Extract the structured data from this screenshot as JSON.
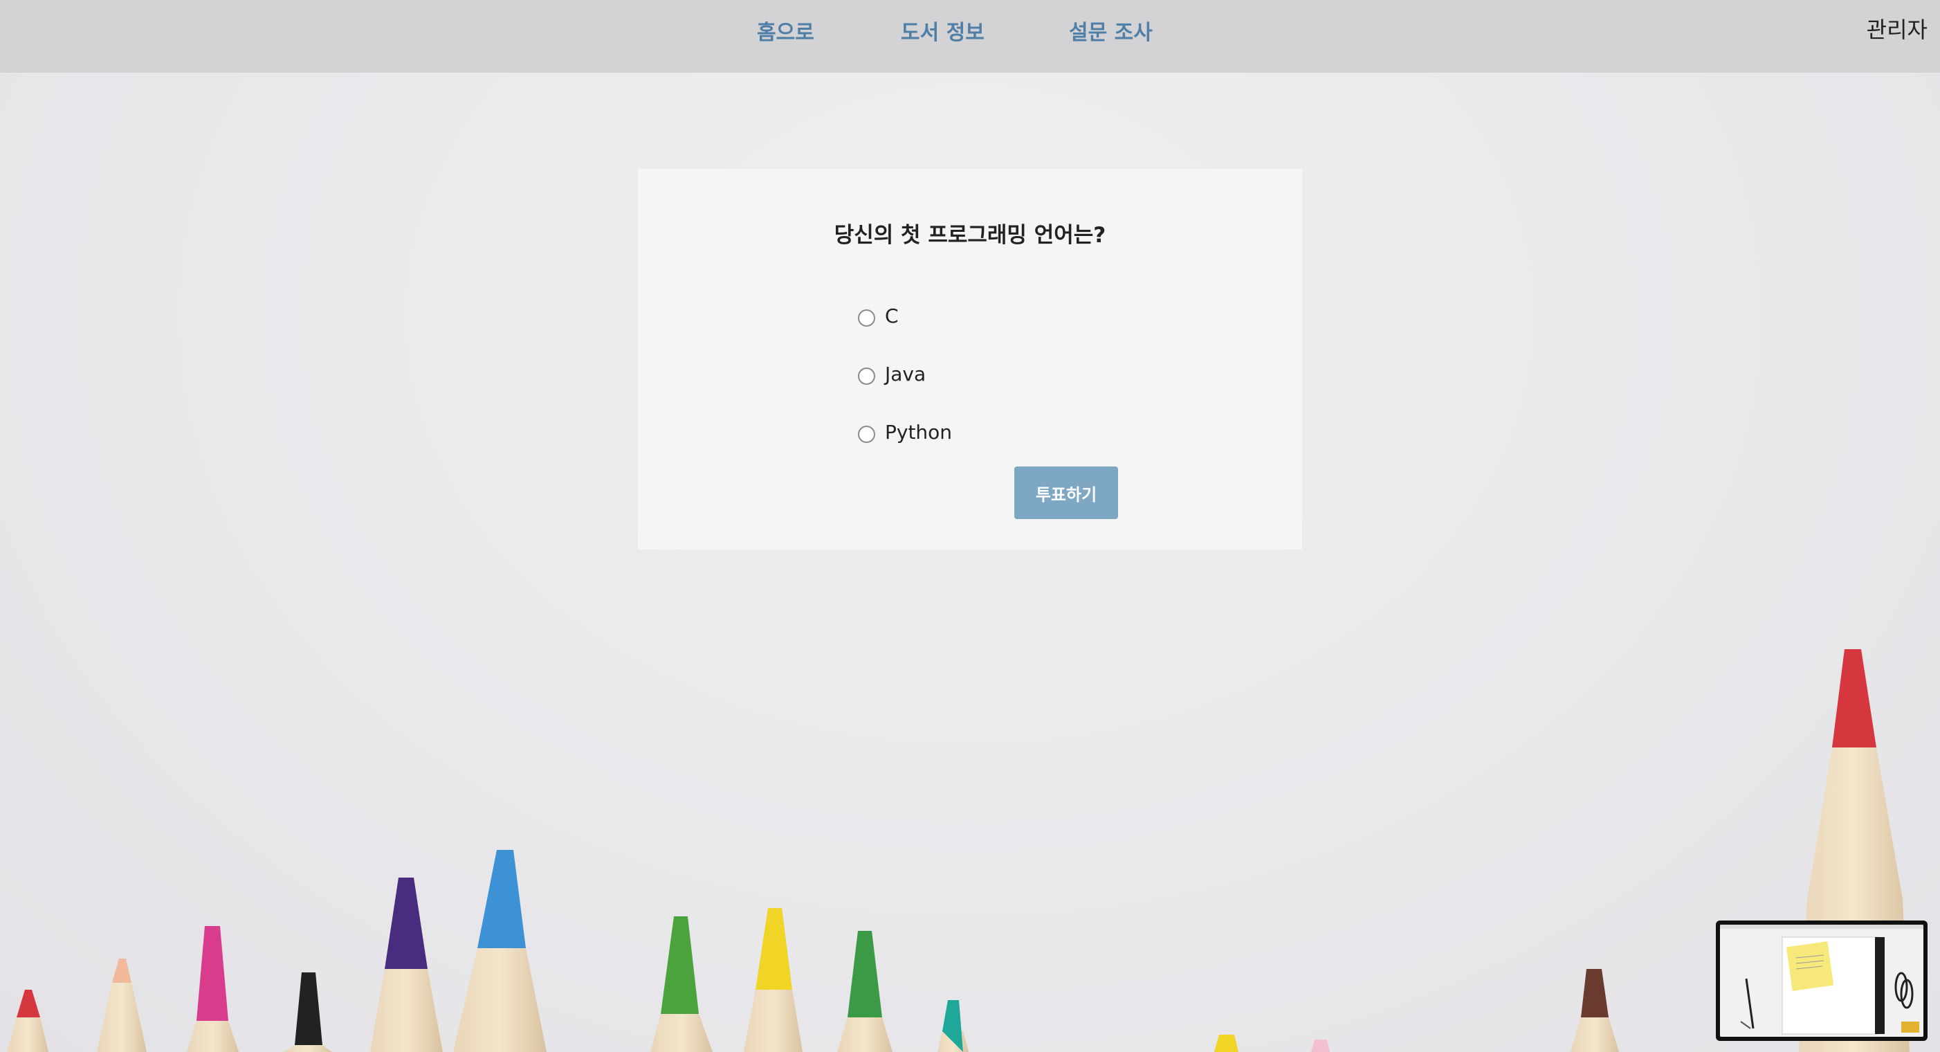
{
  "nav": {
    "home": "홈으로",
    "books": "도서 정보",
    "survey": "설문 조사",
    "admin": "관리자"
  },
  "poll": {
    "question": "당신의 첫 프로그래밍 언어는?",
    "options": [
      "C",
      "Java",
      "Python"
    ],
    "submit_label": "투표하기"
  },
  "colors": {
    "nav_link": "#4f7fa6",
    "button": "#7ea7c4",
    "topbar": "#d3d3d5"
  }
}
